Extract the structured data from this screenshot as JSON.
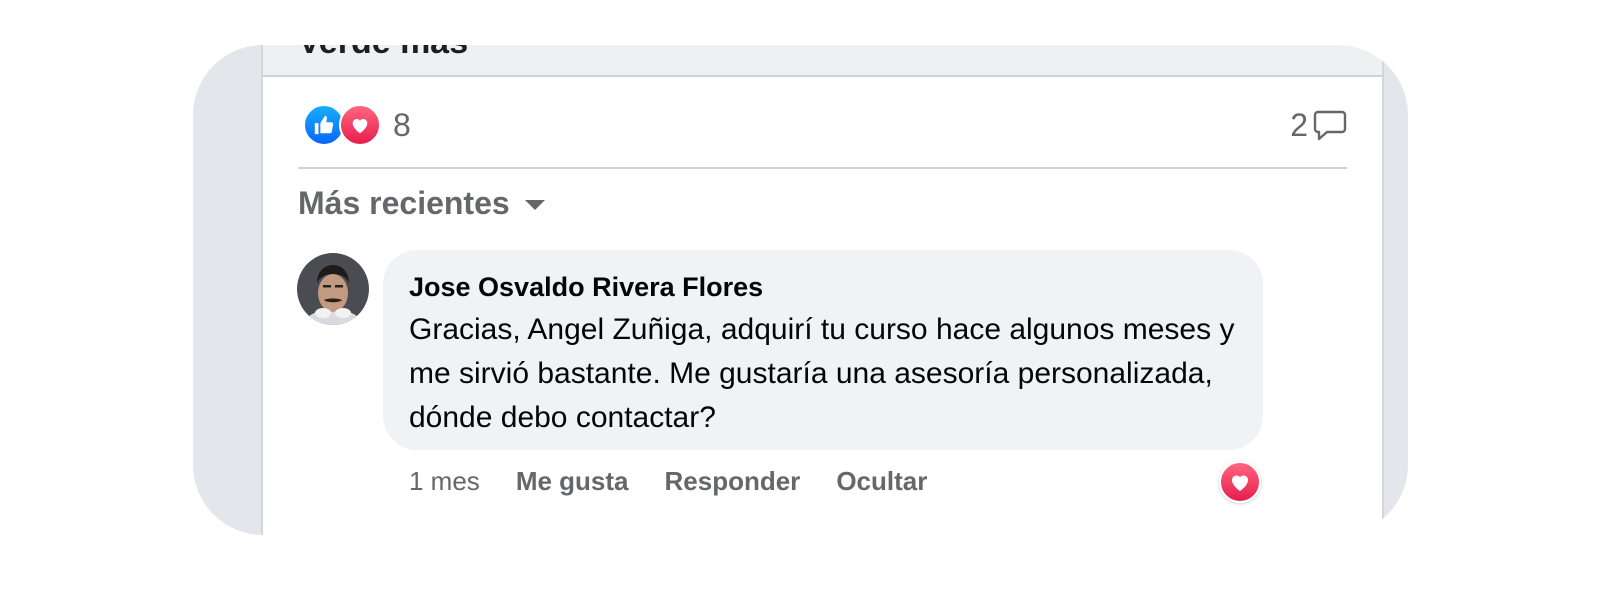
{
  "post": {
    "top_text": "Verde más",
    "reaction_count": "8",
    "reaction_icons": [
      "like-icon",
      "love-icon"
    ],
    "comment_count": "2",
    "comment_icon": "comment-bubble-icon"
  },
  "sort": {
    "label": "Más recientes",
    "icon": "caret-down-icon"
  },
  "comment": {
    "author": "Jose Osvaldo Rivera Flores",
    "text": "Gracias, Angel Zuñiga, adquirí tu curso hace algunos meses y me sirvió bastante. Me gustaría una asesoría personalizada, dónde debo contactar?",
    "time": "1 mes",
    "like_label": "Me gusta",
    "reply_label": "Responder",
    "hide_label": "Ocultar",
    "reaction_icon": "love-icon"
  },
  "colors": {
    "like_blue": "#0866ff",
    "love_red": "#e61e4d",
    "muted_text": "#65676b",
    "bubble_bg": "#f0f2f5"
  }
}
